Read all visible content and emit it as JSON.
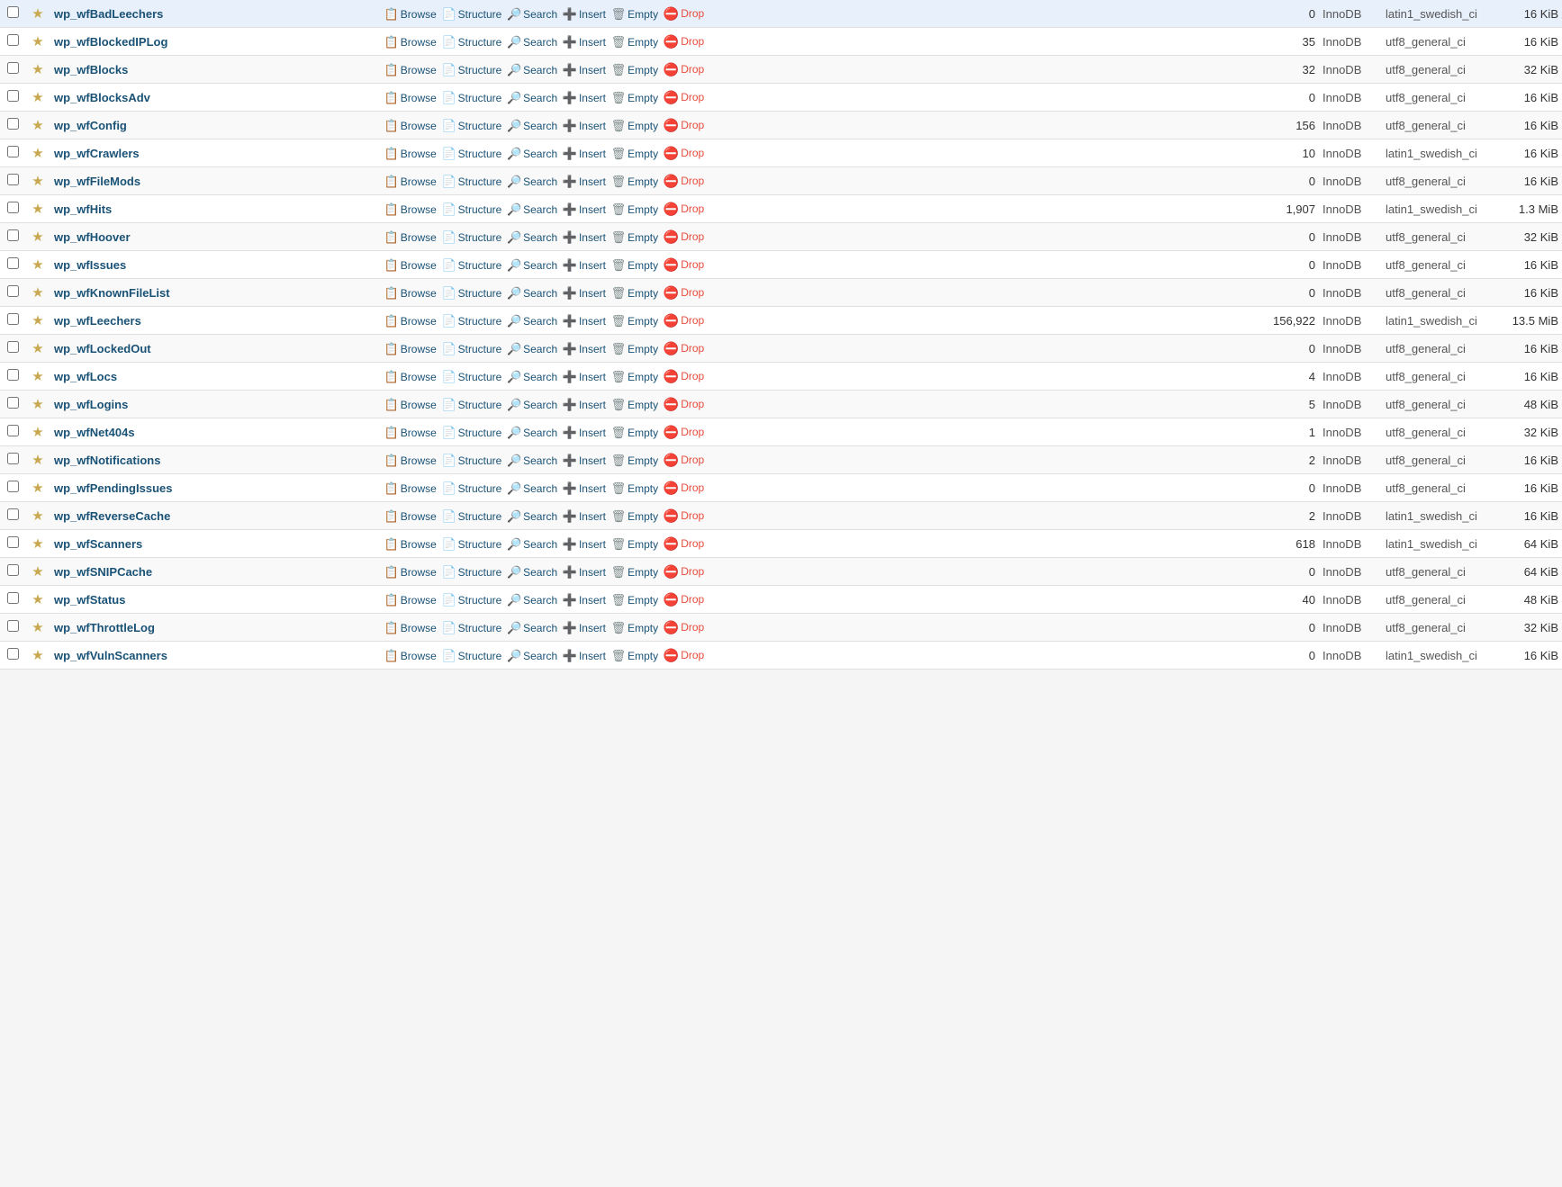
{
  "tables": [
    {
      "name": "wp_wfBadLeechers",
      "rows": "0",
      "engine": "InnoDB",
      "collation": "latin1_swedish_ci",
      "size": "16 KiB"
    },
    {
      "name": "wp_wfBlockedIPLog",
      "rows": "35",
      "engine": "InnoDB",
      "collation": "utf8_general_ci",
      "size": "16 KiB"
    },
    {
      "name": "wp_wfBlocks",
      "rows": "32",
      "engine": "InnoDB",
      "collation": "utf8_general_ci",
      "size": "32 KiB"
    },
    {
      "name": "wp_wfBlocksAdv",
      "rows": "0",
      "engine": "InnoDB",
      "collation": "utf8_general_ci",
      "size": "16 KiB"
    },
    {
      "name": "wp_wfConfig",
      "rows": "156",
      "engine": "InnoDB",
      "collation": "utf8_general_ci",
      "size": "16 KiB"
    },
    {
      "name": "wp_wfCrawlers",
      "rows": "10",
      "engine": "InnoDB",
      "collation": "latin1_swedish_ci",
      "size": "16 KiB"
    },
    {
      "name": "wp_wfFileMods",
      "rows": "0",
      "engine": "InnoDB",
      "collation": "utf8_general_ci",
      "size": "16 KiB"
    },
    {
      "name": "wp_wfHits",
      "rows": "1,907",
      "engine": "InnoDB",
      "collation": "latin1_swedish_ci",
      "size": "1.3 MiB"
    },
    {
      "name": "wp_wfHoover",
      "rows": "0",
      "engine": "InnoDB",
      "collation": "utf8_general_ci",
      "size": "32 KiB"
    },
    {
      "name": "wp_wfIssues",
      "rows": "0",
      "engine": "InnoDB",
      "collation": "utf8_general_ci",
      "size": "16 KiB"
    },
    {
      "name": "wp_wfKnownFileList",
      "rows": "0",
      "engine": "InnoDB",
      "collation": "utf8_general_ci",
      "size": "16 KiB"
    },
    {
      "name": "wp_wfLeechers",
      "rows": "156,922",
      "engine": "InnoDB",
      "collation": "latin1_swedish_ci",
      "size": "13.5 MiB"
    },
    {
      "name": "wp_wfLockedOut",
      "rows": "0",
      "engine": "InnoDB",
      "collation": "utf8_general_ci",
      "size": "16 KiB"
    },
    {
      "name": "wp_wfLocs",
      "rows": "4",
      "engine": "InnoDB",
      "collation": "utf8_general_ci",
      "size": "16 KiB"
    },
    {
      "name": "wp_wfLogins",
      "rows": "5",
      "engine": "InnoDB",
      "collation": "utf8_general_ci",
      "size": "48 KiB"
    },
    {
      "name": "wp_wfNet404s",
      "rows": "1",
      "engine": "InnoDB",
      "collation": "utf8_general_ci",
      "size": "32 KiB"
    },
    {
      "name": "wp_wfNotifications",
      "rows": "2",
      "engine": "InnoDB",
      "collation": "utf8_general_ci",
      "size": "16 KiB"
    },
    {
      "name": "wp_wfPendingIssues",
      "rows": "0",
      "engine": "InnoDB",
      "collation": "utf8_general_ci",
      "size": "16 KiB"
    },
    {
      "name": "wp_wfReverseCache",
      "rows": "2",
      "engine": "InnoDB",
      "collation": "latin1_swedish_ci",
      "size": "16 KiB"
    },
    {
      "name": "wp_wfScanners",
      "rows": "618",
      "engine": "InnoDB",
      "collation": "latin1_swedish_ci",
      "size": "64 KiB"
    },
    {
      "name": "wp_wfSNIPCache",
      "rows": "0",
      "engine": "InnoDB",
      "collation": "utf8_general_ci",
      "size": "64 KiB"
    },
    {
      "name": "wp_wfStatus",
      "rows": "40",
      "engine": "InnoDB",
      "collation": "utf8_general_ci",
      "size": "48 KiB"
    },
    {
      "name": "wp_wfThrottleLog",
      "rows": "0",
      "engine": "InnoDB",
      "collation": "utf8_general_ci",
      "size": "32 KiB"
    },
    {
      "name": "wp_wfVulnScanners",
      "rows": "0",
      "engine": "InnoDB",
      "collation": "latin1_swedish_ci",
      "size": "16 KiB"
    }
  ],
  "actions": {
    "browse": "Browse",
    "structure": "Structure",
    "search": "Search",
    "insert": "Insert",
    "empty": "Empty",
    "drop": "Drop"
  }
}
